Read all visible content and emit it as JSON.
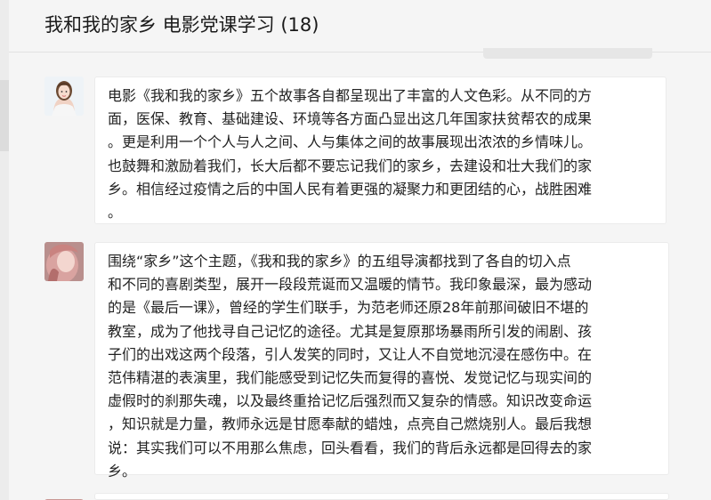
{
  "window": {
    "title": "我和我的家乡 电影党课学习 (18)"
  },
  "messages": [
    {
      "avatar_icon": "woman-portrait-avatar",
      "lines": [
        "电影《我和我的家乡》五个故事各自都呈现出了丰富的人文色彩。从不同的方",
        "面，医保、教育、基础建设、环境等各方面凸显出这几年国家扶贫帮农的成果",
        "。更是利用一个个人与人之间、人与集体之间的故事展现出浓浓的乡情味儿。",
        "也鼓舞和激励着我们，长大后都不要忘记我们的家乡，去建设和壮大我们的家",
        "乡。相信经过疫情之后的中国人民有着更强的凝聚力和更团结的心，战胜困难",
        "。"
      ]
    },
    {
      "avatar_icon": "pink-hair-avatar",
      "lines": [
        "围绕“家乡”这个主题，《我和我的家乡》的五组导演都找到了各自的切入点",
        "和不同的喜剧类型，展开一段段荒诞而又温暖的情节。我印象最深，最为感动",
        "的是《最后一课》，曾经的学生们联手，为范老师还原28年前那间破旧不堪的",
        "教室，成为了他找寻自己记忆的途径。尤其是复原那场暴雨所引发的闹剧、孩",
        "子们的出戏这两个段落，引人发笑的同时，又让人不自觉地沉浸在感伤中。在",
        "范伟精湛的表演里，我们能感受到记忆失而复得的喜悦、发觉记忆与现实间的",
        "虚假时的刹那失魂，以及最终重拾记忆后强烈而又复杂的情感。知识改变命运",
        "，知识就是力量，教师永远是甘愿奉献的蜡烛，点亮自己燃烧别人。最后我想",
        "说：其实我们可以不用那么焦虑，回头看看，我们的背后永远都是回得去的家",
        "乡。"
      ]
    },
    {
      "avatar_icon": "pink-hair-avatar",
      "lines": []
    }
  ]
}
